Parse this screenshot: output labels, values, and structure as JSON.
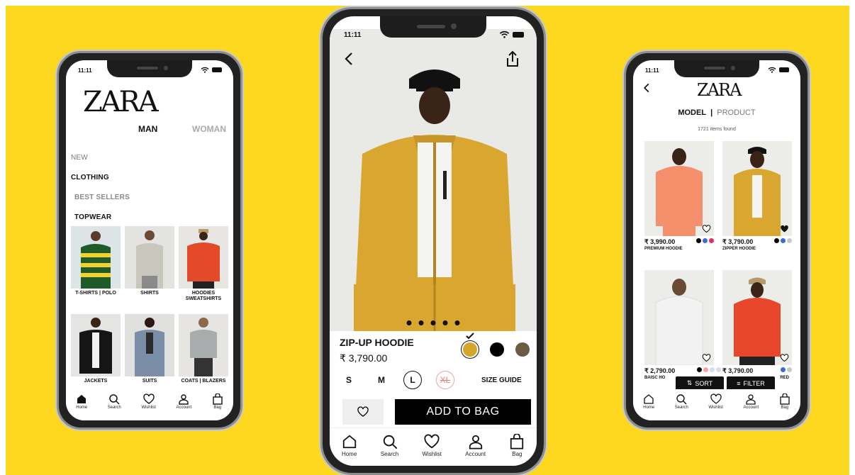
{
  "colors": {
    "background": "#FDD81E",
    "black": "#000000"
  },
  "phone1": {
    "time": "11:11",
    "logo": "ZARA",
    "tabs": {
      "man": "MAN",
      "woman": "WOMAN"
    },
    "links": [
      "NEW",
      "CLOTHING",
      "BEST SELLERS",
      "TOPWEAR"
    ],
    "grid": [
      {
        "label": "T-SHIRTS | POLO"
      },
      {
        "label": "SHIRTS"
      },
      {
        "label": "HOODIES SWEATSHIRTS"
      },
      {
        "label": "JACKETS"
      },
      {
        "label": "SUITS"
      },
      {
        "label": "COATS | BLAZERS"
      }
    ],
    "nav": [
      "Home",
      "Search",
      "Wishlist",
      "Account",
      "Bag"
    ]
  },
  "phone2": {
    "time": "11:11",
    "product_name": "ZIP-UP HOODIE",
    "price": "₹ 3,790.00",
    "swatches": [
      "#D4A62A",
      "#000000",
      "#6B5B45"
    ],
    "sizes": [
      "S",
      "M",
      "L",
      "XL"
    ],
    "size_guide": "SIZE GUIDE",
    "add_to_bag": "ADD TO BAG",
    "nav": [
      "Home",
      "Search",
      "Wishlist",
      "Account",
      "Bag"
    ]
  },
  "phone3": {
    "time": "11:11",
    "logo": "ZARA",
    "model": "MODEL",
    "sep": "|",
    "product": "PRODUCT",
    "count": "1721 items found",
    "cards": [
      {
        "price": "₹ 3,990.00",
        "name": "PREMIUM HOODIE",
        "colors": [
          "#000000",
          "#3A6BD6",
          "#E0306A"
        ]
      },
      {
        "price": "₹ 3,790.00",
        "name": "ZIPPER HOODIE",
        "colors": [
          "#000000",
          "#3A6BD6",
          "#C8C8C8"
        ]
      },
      {
        "price": "₹ 2,790.00",
        "name": "BAISC HO",
        "colors": [
          "#000000",
          "#F2A3A3",
          "#CFE0F5",
          "#D9D9F0"
        ]
      },
      {
        "price": "₹ 3,790.00",
        "name": "RED",
        "colors": [
          "#3A6BD6",
          "#C8C8C8"
        ]
      }
    ],
    "sort": "SORT",
    "filter": "FILTER",
    "nav": [
      "Home",
      "Search",
      "Wishlist",
      "Account",
      "Bag"
    ]
  }
}
